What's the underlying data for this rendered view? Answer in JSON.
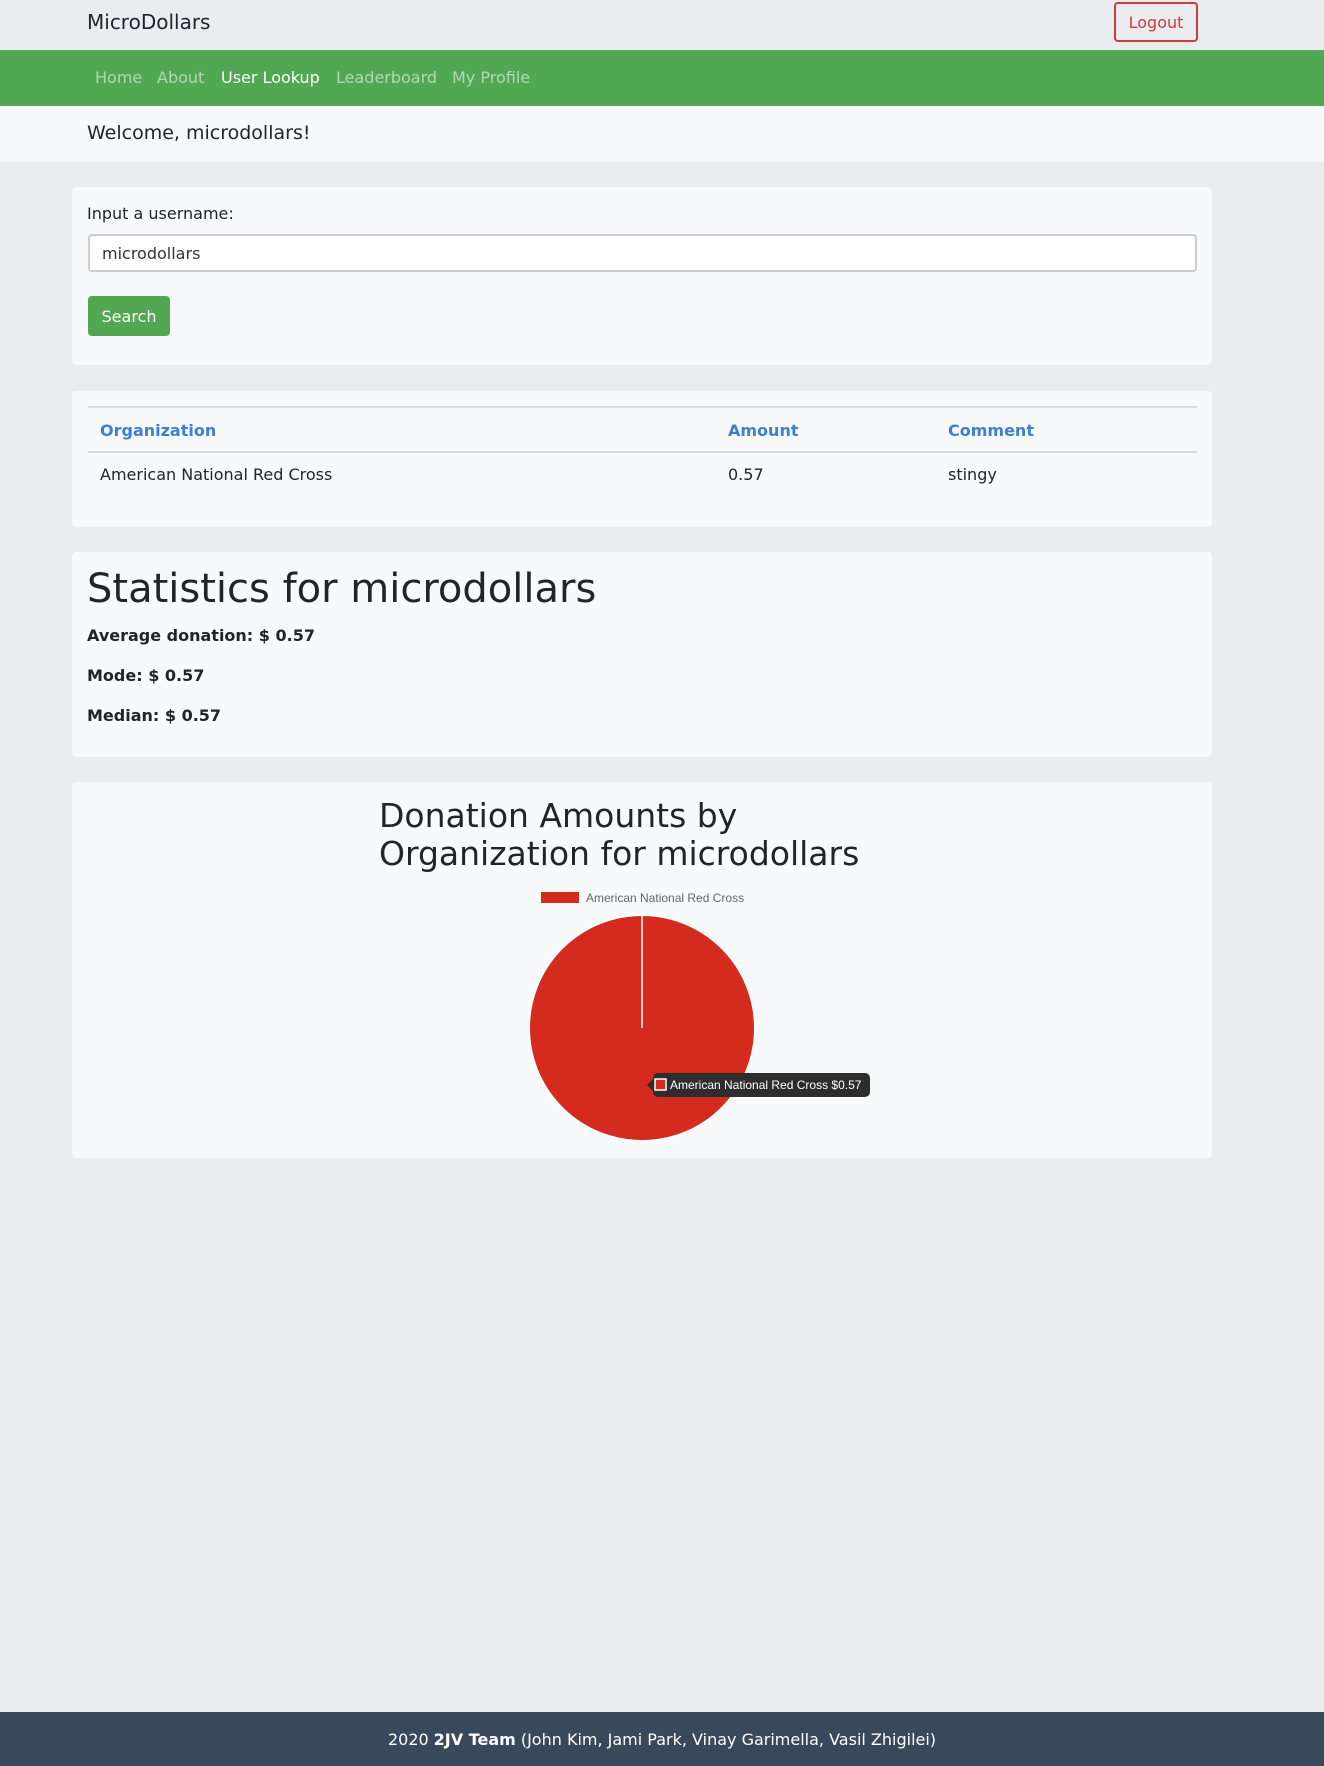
{
  "header": {
    "brand": "MicroDollars",
    "logout_label": "Logout"
  },
  "nav": {
    "items": [
      "Home",
      "About",
      "User Lookup",
      "Leaderboard",
      "My Profile"
    ],
    "active": "User Lookup"
  },
  "welcome": "Welcome, microdollars!",
  "search": {
    "label": "Input a username:",
    "value": "microdollars",
    "button_label": "Search"
  },
  "table": {
    "headers": [
      "Organization",
      "Amount",
      "Comment"
    ],
    "rows": [
      [
        "American National Red Cross",
        "0.57",
        "stingy"
      ]
    ]
  },
  "stats": {
    "title": "Statistics for microdollars",
    "average": "Average donation: $ 0.57",
    "mode": "Mode: $ 0.57",
    "median": "Median: $ 0.57"
  },
  "chart_data": {
    "type": "pie",
    "title": "Donation Amounts by Organization for microdollars",
    "categories": [
      "American National Red Cross"
    ],
    "values": [
      0.57
    ],
    "colors": [
      "#d52b1e"
    ],
    "legend": [
      "American National Red Cross"
    ],
    "legend_position": "top",
    "tooltip": "American National Red Cross $0.57"
  },
  "footer": {
    "year": "2020",
    "team": "2JV Team",
    "members": "(John Kim, Jami Park, Vinay Garimella, Vasil Zhigilei)"
  },
  "colors": {
    "nav_green": "#52a852",
    "logout_red": "#cf3a3a",
    "header_blue": "#3b7fd6",
    "footer_bg": "#3a485c"
  }
}
